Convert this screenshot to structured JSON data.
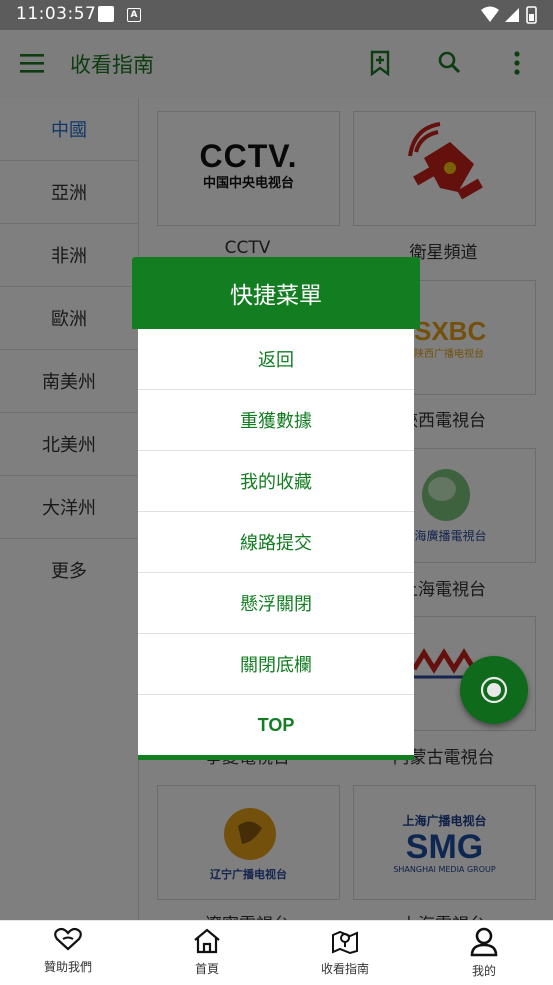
{
  "status_bar": {
    "time": "11:03:57"
  },
  "toolbar": {
    "title": "收看指南",
    "icons": [
      "menu-icon",
      "bookmark-add-icon",
      "search-icon",
      "more-vert-icon"
    ]
  },
  "sidebar": {
    "items": [
      {
        "label": "中國",
        "active": true
      },
      {
        "label": "亞洲"
      },
      {
        "label": "非洲"
      },
      {
        "label": "歐洲"
      },
      {
        "label": "南美州"
      },
      {
        "label": "北美州"
      },
      {
        "label": "大洋州"
      },
      {
        "label": "更多"
      }
    ]
  },
  "channels": [
    {
      "label": "CCTV",
      "logo_text": "CCTV.",
      "logo_sub": "中国中央电视台"
    },
    {
      "label": "衛星頻道"
    },
    {
      "label": "陝西電視台",
      "logo_text": "SXBC",
      "logo_sub": "陕西广播电视台"
    },
    {
      "label": "上海電視台",
      "logo_sub": "上海廣播電視台"
    },
    {
      "label": "寧夏電視台"
    },
    {
      "label": "內蒙古電視台"
    },
    {
      "label": "遼寧電視台",
      "logo_sub": "辽宁广播电视台"
    },
    {
      "label": "上海電視台",
      "logo_text": "SMG",
      "logo_top": "上海广播电视台",
      "logo_sub": "SHANGHAI MEDIA GROUP"
    }
  ],
  "dialog": {
    "title": "快捷菜單",
    "items": [
      "返回",
      "重獲數據",
      "我的收藏",
      "線路提交",
      "懸浮關閉",
      "關閉底欄",
      "TOP"
    ]
  },
  "bottom_nav": [
    {
      "label": "贊助我們",
      "icon": "heart-hands-icon"
    },
    {
      "label": "首頁",
      "icon": "home-icon"
    },
    {
      "label": "收看指南",
      "icon": "map-pin-icon"
    },
    {
      "label": "我的",
      "icon": "person-icon"
    }
  ],
  "colors": {
    "primary": "#137d22",
    "active_side": "#1f6fd1",
    "status_bar": "#5c5c5c"
  }
}
